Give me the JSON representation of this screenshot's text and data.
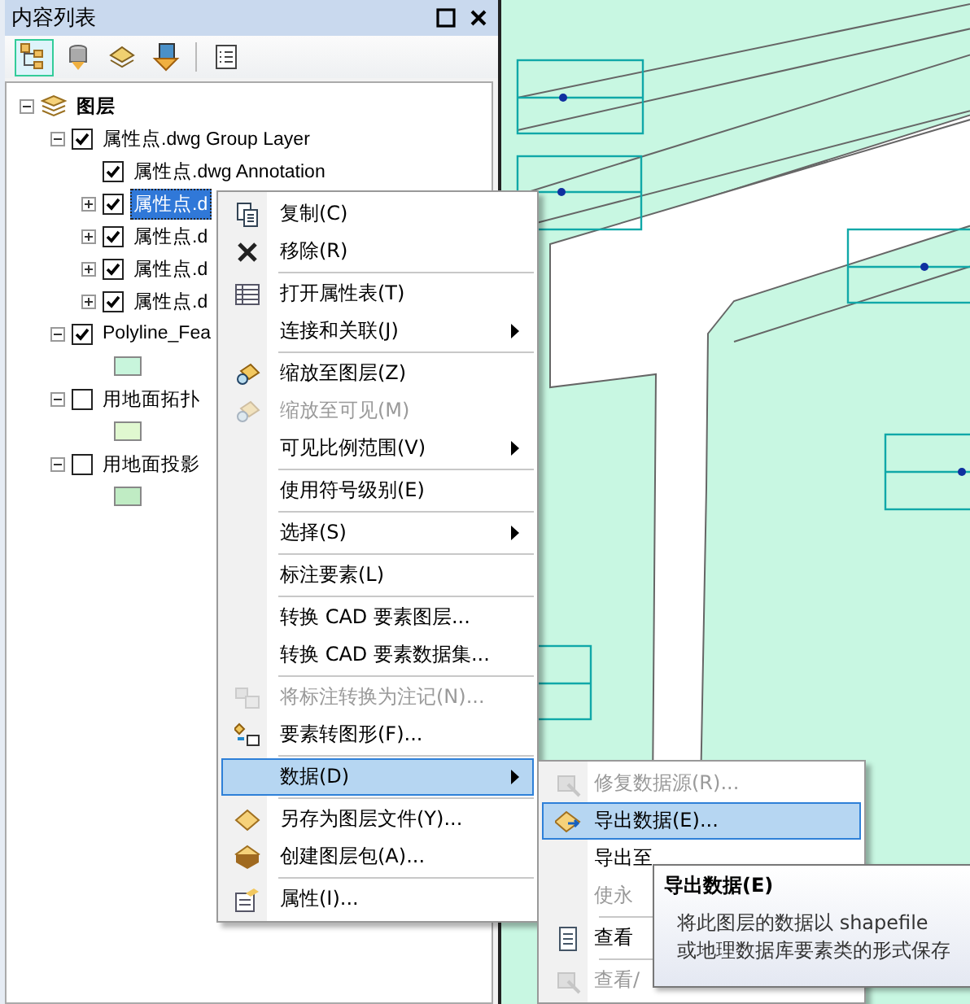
{
  "panel": {
    "title": "内容列表"
  },
  "toolbar": [
    {
      "selected": true
    },
    {
      "selected": false
    },
    {
      "selected": false
    },
    {
      "selected": false
    },
    {
      "selected": false
    }
  ],
  "tree": [
    {
      "label": "图层",
      "kind": "root",
      "expanded": true,
      "selected": false,
      "children": [
        {
          "label": "属性点.dwg Group Layer",
          "kind": "layer",
          "expanded": true,
          "checked": true,
          "selected": false,
          "children": [
            {
              "label": "属性点.dwg Annotation",
              "kind": "layer",
              "checked": true,
              "selected": false
            },
            {
              "label": "属性点.d",
              "kind": "layer",
              "expanded": false,
              "checked": true,
              "selected": true
            },
            {
              "label": "属性点.d",
              "kind": "layer",
              "expanded": false,
              "checked": true,
              "selected": false
            },
            {
              "label": "属性点.d",
              "kind": "layer",
              "expanded": false,
              "checked": true,
              "selected": false
            },
            {
              "label": "属性点.d",
              "kind": "layer",
              "expanded": false,
              "checked": true,
              "selected": false
            }
          ]
        },
        {
          "label": "Polyline_Fea",
          "kind": "layer",
          "expanded": true,
          "checked": true,
          "selected": false,
          "children": [
            {
              "kind": "swatch",
              "color": "#c8f5dc"
            }
          ]
        },
        {
          "label": "用地面拓扑",
          "kind": "layer",
          "expanded": true,
          "checked": false,
          "selected": false,
          "children": [
            {
              "kind": "swatch",
              "color": "#e0f8d0"
            }
          ]
        },
        {
          "label": "用地面投影",
          "kind": "layer",
          "expanded": true,
          "checked": false,
          "selected": false,
          "children": [
            {
              "kind": "swatch",
              "color": "#c0ecc4"
            }
          ]
        }
      ]
    }
  ],
  "context_menu": [
    {
      "kind": "item",
      "label": "复制(C)",
      "disabled": false,
      "submenu": false,
      "selected": false
    },
    {
      "kind": "item",
      "label": "移除(R)",
      "disabled": false,
      "submenu": false,
      "selected": false
    },
    {
      "kind": "separator"
    },
    {
      "kind": "item",
      "label": "打开属性表(T)",
      "disabled": false,
      "submenu": false,
      "selected": false
    },
    {
      "kind": "item",
      "label": "连接和关联(J)",
      "disabled": false,
      "submenu": true,
      "selected": false
    },
    {
      "kind": "separator"
    },
    {
      "kind": "item",
      "label": "缩放至图层(Z)",
      "disabled": false,
      "submenu": false,
      "selected": false
    },
    {
      "kind": "item",
      "label": "缩放至可见(M)",
      "disabled": true,
      "submenu": false,
      "selected": false
    },
    {
      "kind": "item",
      "label": "可见比例范围(V)",
      "disabled": false,
      "submenu": true,
      "selected": false
    },
    {
      "kind": "separator"
    },
    {
      "kind": "item",
      "label": "使用符号级别(E)",
      "disabled": false,
      "submenu": false,
      "selected": false
    },
    {
      "kind": "separator"
    },
    {
      "kind": "item",
      "label": "选择(S)",
      "disabled": false,
      "submenu": true,
      "selected": false
    },
    {
      "kind": "separator"
    },
    {
      "kind": "item",
      "label": "标注要素(L)",
      "disabled": false,
      "submenu": false,
      "selected": false
    },
    {
      "kind": "separator"
    },
    {
      "kind": "item",
      "label": "转换 CAD 要素图层...",
      "disabled": false,
      "submenu": false,
      "selected": false
    },
    {
      "kind": "item",
      "label": "转换 CAD 要素数据集...",
      "disabled": false,
      "submenu": false,
      "selected": false
    },
    {
      "kind": "separator"
    },
    {
      "kind": "item",
      "label": "将标注转换为注记(N)...",
      "disabled": true,
      "submenu": false,
      "selected": false
    },
    {
      "kind": "item",
      "label": "要素转图形(F)...",
      "disabled": false,
      "submenu": false,
      "selected": false
    },
    {
      "kind": "separator"
    },
    {
      "kind": "item",
      "label": "数据(D)",
      "disabled": false,
      "submenu": true,
      "selected": true
    },
    {
      "kind": "separator"
    },
    {
      "kind": "item",
      "label": "另存为图层文件(Y)...",
      "disabled": false,
      "submenu": false,
      "selected": false
    },
    {
      "kind": "item",
      "label": "创建图层包(A)...",
      "disabled": false,
      "submenu": false,
      "selected": false
    },
    {
      "kind": "separator"
    },
    {
      "kind": "item",
      "label": "属性(I)...",
      "disabled": false,
      "submenu": false,
      "selected": false
    }
  ],
  "data_submenu": [
    {
      "kind": "item",
      "label": "修复数据源(R)...",
      "disabled": true,
      "selected": false
    },
    {
      "kind": "item",
      "label": "导出数据(E)...",
      "disabled": false,
      "selected": true
    },
    {
      "kind": "item",
      "label": "导出至",
      "disabled": false,
      "selected": false
    },
    {
      "kind": "item",
      "label": "使永",
      "disabled": true,
      "selected": false
    },
    {
      "kind": "separator"
    },
    {
      "kind": "item",
      "label": "查看",
      "disabled": false,
      "selected": false
    },
    {
      "kind": "separator"
    },
    {
      "kind": "item",
      "label": "查看/",
      "disabled": true,
      "selected": false
    }
  ],
  "tooltip": {
    "title": "导出数据(E)",
    "lines": [
      "将此图层的数据以 shapefile",
      "或地理数据库要素类的形式保存"
    ]
  }
}
